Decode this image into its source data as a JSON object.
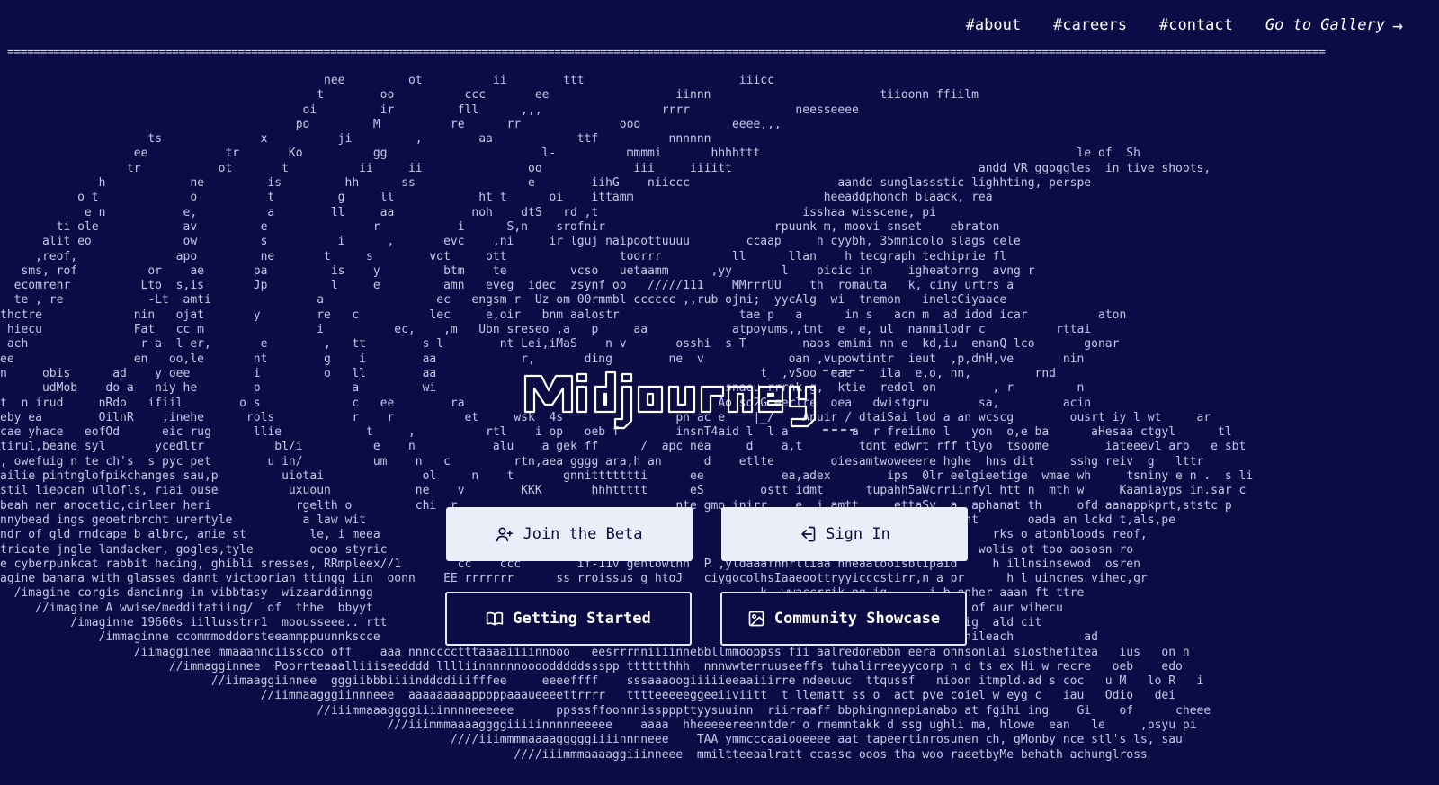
{
  "nav": {
    "about": "#about",
    "careers": "#careers",
    "contact": "#contact",
    "gallery": "Go to Gallery",
    "gallery_arrow": "→"
  },
  "logo_text": "Midjourney",
  "buttons": {
    "join_beta": "Join the Beta",
    "sign_in": "Sign In",
    "getting_started": "Getting Started",
    "community_showcase": "Community Showcase"
  },
  "colors": {
    "background": "#0b0b45",
    "text": "#d9dbf2",
    "button_light": "#ebeef8"
  },
  "icons": [
    "user-plus-icon",
    "sign-in-icon",
    "book-icon",
    "image-icon",
    "arrow-right-icon"
  ],
  "rule_text": "========================================================================================================================================================================================================",
  "ascii_art": "                                              nee         ot          ii        ttt                      iiicc\n                                             t        oo          ccc       ee                  iinnn                        tiioonn ffiilm\n                                           oi         ir         fll      ,,,                 rrrr               neesseeee\n                                          po         M          re      rr              ooo             eeee,,,\n                     ts              x          ji         ,        aa            ttf          nnnnnn\n                   ee           tr       Ko          gg                      l-          mmmmi       hhhhttt                                             le of  Sh\n                  tr           ot       t          ii     ii               oo             iii     iiiitt                                   andd VR ggoggles  in tive shoots,\n              h            ne         is         hh      ss                e        iihG    niiccc                     aandd sunglassstic lighhting, perspe\n           o t             o          t         g     ll            ht t      oi    ittamm                           heeaddphonch blaack, rea\n            e n           e,          a        ll     aa           noh    dtS   rd ,t                             isshaa wisscene, pi\n        ti ole            av         e               r           i      S,n    srofnir                        rpuunk m, moovi snset    ebraton\n      alit eo             ow         s          i      ,       evc    ,ni     ir lguj naipoottuuuu        ccaap     h cyybh, 35mnicolo slags cele\n     ,reof,              apo         ne       t     s        vot     ott                toorrr          ll      llan    h tecgraph techiprie fl\n   sms, rof          or    ae       pa         is    y         btm    te         vcso   uetaamm      ,yy       l    picic in     igheatorng  avng r\n  ecomrenr          Lto  s,is       Jp         l     e         amn   eveg  idec  zsynf oo   /////111    MMrrrUU    th  romauta   k, ciny urtrs a\n  te , re            -Lt  amti               a                ec   engsm r  Uz om 00rmmbl cccccc ,,rub ojni;  yycAlg  wi  tnemon   inelcCiyaace\nthctre             nin   ojat       y        re   c          lec     e,oir   bnm aalostr                 tae p   a      in s   acn m  ad idod icar          aton\n hiecu             Fat   cc m                i          ec,    ,m   Ubn sreseo ,a   p     aa            atpoyums,,tnt  e  e, ul  nanmilodr c          rttai\n ach                r a  l er,       e        ,   tt        s l        nt Lei,iMaS    n v       osshi  s T        naos emimi nn e  kd,iu  enanQ lco       gonar\nee                 en   oo,le       nt        g    i        aa            r,       ding        ne  v            oan ,vupowtintr  ieut  ,p,dnH,ve       nin\nn     obis      ad    y oee         i         o   ll        aa                                              t  ,vSoo  eae    ila  e,o, nn,         rnd\n      udMob    do a   niy he        p             a         wi                                         snaeu rrrnk g,  ktie  redol on        , r         n\nt  n irud     nRdo   ifiil        o s             c   ee        ra                                    Ao so2G eerlre  oea   dwistgru       sa,         acin\neby ea        OilnR    ,inehe      rols           r    r          et     wsk  4s                pn ac e    |_/    Anuir / dtaiSai lod a an wcscg        ousrt iy l wt     ar\ncae yhace   eofOd      eic rug      llie            t     ,          rtl    i op   oeb f        insnT4aid l  l a         a  r freiimo l   yon  o,e ba      aHesaa ctgyl      tl\ntirul,beane syl       ycedltr          bl/i          e    n           alu    a gek ff      /  apc nea     d    a,t        tdnt edwrt rff tlyo  tsoome        iateeevl aro   e sbt\n, owefuig n te ch's  s pyc pet        u in/          um    n   c         rtn,aea gggg ara,h an      d    etlte        oiesamtwoweeere hghe  hns dit     sshg reiv  g   lttr\nailie pintnglofpikchanges sau,p         uiotai              ol     n    t       gnnittttttti      ee           ea,adex        ips  0lr eelgieetige  wmae wh     tsniny e n .  s li\nstil lieocan ullofls, riai ouse          uxuoun            ne    v        KKK       hhhttttt      eS        ostt idmt      tupahh5aWcrriinfyl htt n  mth w     Kaaniayps in.sar c\nbeah ner anocetic,cirleer heri            rgelth o         chi  r                               nte gmo inirr    e  i amtt     ettaSy  a, aphanat th     ofd aanappkprt,ststc p\nnnybead ings geoetrbrcht urertyle          a law wit                                                            vhtyaa  e  nsdrn  ak ri tnt       oada an lckd t,als,pe\nndr of gld rndcape b albrc, anie st         le, i meea                                                        b npll dhnaoeeiongrctotymo     rks o atonbloods reof,\ntricate jngle landacker, gogles,tyle        ocoo styric                                                      ii aa oo tthtt oglacard       wolis ot too aososn ro\ne cyberpunkcat rabbit hacing, ghibli sresses, RRmpleex//1        cc    ccc        if-11v gentowtnh  P ,yldaaafhnrlliaa hheaatooisblipaid     h illnsinsewod  osren\nagine banana with glasses dannt victoorian ttingg iin  oonn    EE rrrrrrr      ss rroissus g htoJ   ciygocolhsIaaeoottryyicccstirr,n a pr      h l uincnes vihec,gr\n  /imagine corgis dancinng in vibbtasy  wizaarddinngg                                                       k  wwaccrrik,ng ig ,    i b enher aaan ft ttre\n     //imagine A wwise/medditatiing/  of  thhe  bbyyt                                                      mttr h  eeskwiminaaefkwd brd t of aur wihecu\n          /imaginne 19660s iillusstrr1  moousseee.. rtt                                                   euuoteeemaraoolduree kre g i emig  ald cit\n              /immaginne ccommmoddorsteeammppuunnkscce                                                  gon rr  dddho m  n spie r ystsi anileach          ad\n                   /iimagginee mmaaannciisscco off    aaa nnncccctttaaaaiiiinnooo   eesrrrnniiiinnebbllmmooppss fii aalredonebbn eera onnsonlai siosthefitea   ius   on n\n                        //immagginnee  Poorrteaaalliiiseedddd lllliinnnnnnoooodddddssspp tttttthhh  nnnwwterruuseeffs tuhalirreeyycorp n d ts ex Hi w recre   oeb    edo\n                              //iimaaggiinnee  gggiibbbiiiinddddiiifffee     eeeeffff    sssaaaoogiiiiieeaaiiirre ndeeuuc  ttqussf   nioon itmpld.ad s coc   u M   lo R   i\n                                     //iimmaagggiinnneee  aaaaaaaaapppppaaaueeeettrrrr   tttteeeeeggeeiiviitt  t llematt ss o  act pve coiel w eyg c   iau   Odio   dei\n                                             //iiimmaaaggggiiiinnnneeeeee      ppsssffoonnnisspppttyysuuinn  riirraaff bbphingnnepianabo at fgihi ing    Gi    of      cheee\n                                                       ///iiimmmaaaaggggiiiiinnnnneeeee    aaaa  hheeeeereenntder o rmemntakk d ssg ughli ma, hlowe  ean   le     ,psyu pi\n                                                                ////iiimmmmaaaagggggiiiinnnneee    TAA ymmcccaaiooeeee aat tapeertinrosunen ch, gMonby nce stl's ls, sau\n                                                                         ////iiimmmaaaaggiiinneee  mmiltteeaalratt ccassc ooos tha woo raeetbyMe behath achunglross"
}
